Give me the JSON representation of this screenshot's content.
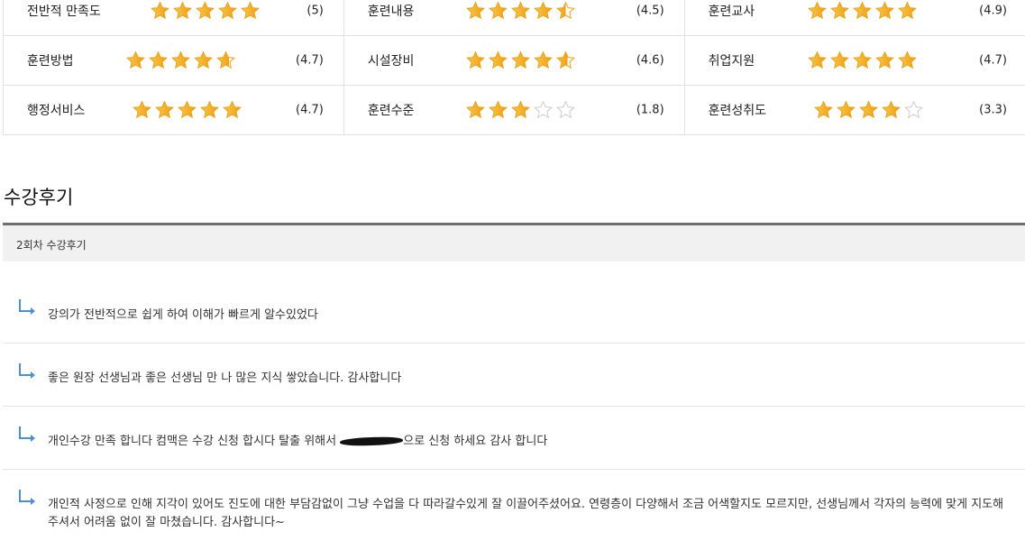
{
  "ratings": [
    [
      {
        "label": "전반적 만족도",
        "stars": 5.0,
        "score": "(5)"
      },
      {
        "label": "훈련내용",
        "stars": 4.5,
        "score": "(4.5)"
      },
      {
        "label": "훈련교사",
        "stars": 5.0,
        "score": "(4.9)"
      }
    ],
    [
      {
        "label": "훈련방법",
        "stars": 4.7,
        "score": "(4.7)"
      },
      {
        "label": "시설장비",
        "stars": 4.6,
        "score": "(4.6)"
      },
      {
        "label": "취업지원",
        "stars": 5.0,
        "score": "(4.7)"
      }
    ],
    [
      {
        "label": "행정서비스",
        "stars": 5.0,
        "score": "(4.7)"
      },
      {
        "label": "훈련수준",
        "stars": 3.0,
        "score": "(1.8)"
      },
      {
        "label": "훈련성취도",
        "stars": 4.0,
        "score": "(3.3)"
      }
    ]
  ],
  "section": {
    "title": "수강후기"
  },
  "review_header": {
    "label": "2회차 수강후기"
  },
  "reviews": [
    {
      "text": "강의가 전반적으로 쉽게 하여 이해가 빠르게 알수있었다"
    },
    {
      "text": "좋은 원장 선생님과 좋은 선생님 만 나 많은 지식 쌓았습니다. 감사합니다"
    },
    {
      "text_before": "개인수강 만족 합니다 컴맥은 수강 신청 합시다 탈출 위해서 ",
      "text_after": "으로 신청 하세요 감사 합니다"
    },
    {
      "text": "개인적 사정으로 인해 지각이 있어도 진도에 대한 부담감없이 그냥 수업을 다 따라갈수있게 잘 이끌어주셨어요. 연령층이 다양해서 조금 어색할지도 모르지만, 선생님께서 각자의 능력에 맞게 지도해주셔서 어려움 없이 잘 마쳤습니다. 감사합니다~"
    }
  ],
  "colors": {
    "star_fill": "#f5a623",
    "star_empty": "#cccccc",
    "arrow": "#4a8fd8"
  }
}
